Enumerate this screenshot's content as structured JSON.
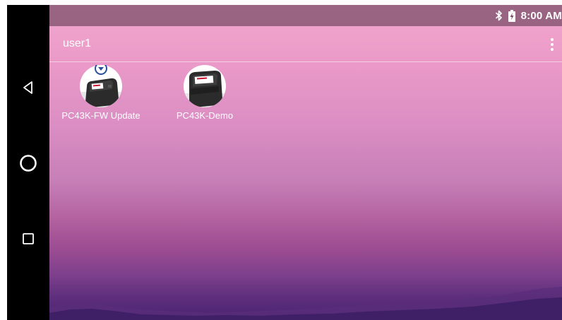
{
  "status_bar": {
    "time": "8:00 AM",
    "icons": [
      "bluetooth-icon",
      "battery-charging-icon"
    ]
  },
  "header": {
    "user": "user1",
    "menu_icon": "more-vert-icon"
  },
  "apps": [
    {
      "label": "PC43K-FW Update",
      "icon": "pc43k-fw-update-icon"
    },
    {
      "label": "PC43K-Demo",
      "icon": "pc43k-demo-icon"
    }
  ],
  "navigation": {
    "buttons": [
      "back-icon",
      "home-icon",
      "recents-icon"
    ]
  },
  "colors": {
    "nav_background": "#000000",
    "status_bar": "#7a4a66",
    "wallpaper_top": "#f2a8cd",
    "wallpaper_bottom": "#4a2470",
    "printer_body": "#2b2b2b",
    "brand_red": "#c8102e"
  }
}
